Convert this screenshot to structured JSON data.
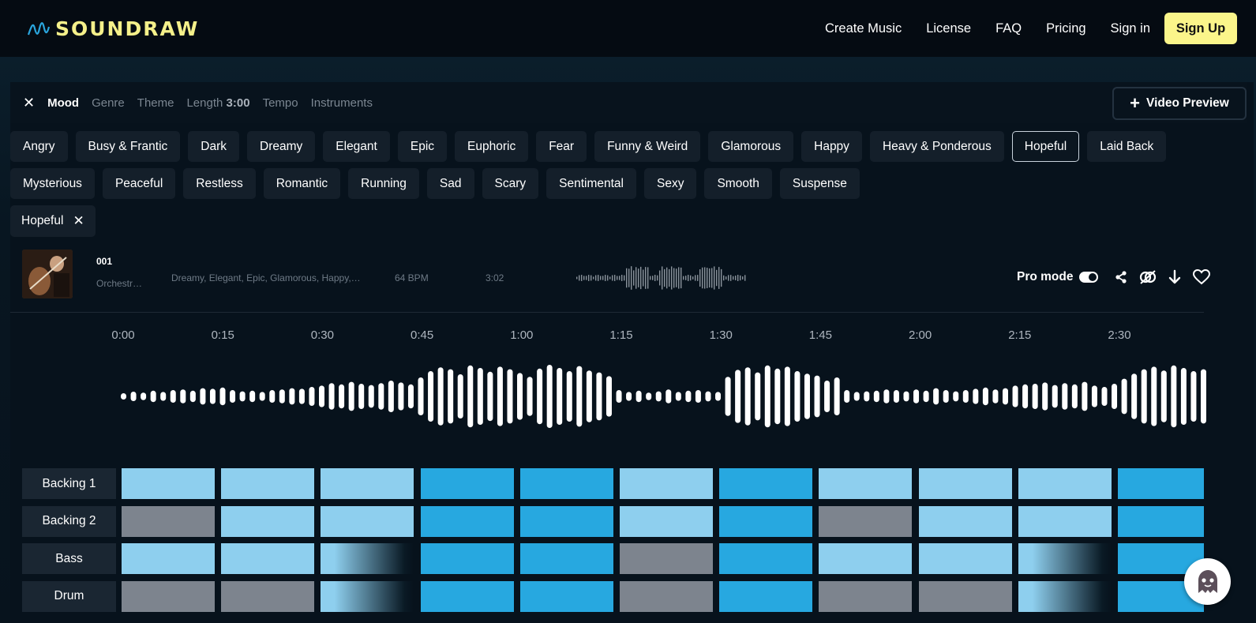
{
  "header": {
    "logo_text": "SOUNDRAW",
    "nav": [
      "Create Music",
      "License",
      "FAQ",
      "Pricing",
      "Sign in"
    ],
    "signup_label": "Sign Up"
  },
  "filters": {
    "tabs": [
      "Mood",
      "Genre",
      "Theme",
      "Tempo",
      "Instruments"
    ],
    "length_label": "Length",
    "length_value": "3:00",
    "video_preview_label": "Video Preview"
  },
  "moods": {
    "row1": [
      "Angry",
      "Busy & Frantic",
      "Dark",
      "Dreamy",
      "Elegant",
      "Epic",
      "Euphoric",
      "Fear",
      "Funny & Weird",
      "Glamorous",
      "Happy",
      "Heavy & Ponderous",
      "Hopeful",
      "Laid Back"
    ],
    "row2": [
      "Mysterious",
      "Peaceful",
      "Restless",
      "Romantic",
      "Running",
      "Sad",
      "Scary",
      "Sentimental",
      "Sexy",
      "Smooth",
      "Suspense"
    ],
    "selected": "Hopeful"
  },
  "selected_filter": {
    "label": "Hopeful"
  },
  "track": {
    "id": "001",
    "genre": "Orchestr…",
    "moods": "Dreamy, Elegant, Epic, Glamorous, Happy,…",
    "bpm": "64 BPM",
    "length": "3:02",
    "pro_mode_label": "Pro mode",
    "pro_mode_on": true
  },
  "timeline": [
    "0:00",
    "0:15",
    "0:30",
    "0:45",
    "1:00",
    "1:15",
    "1:30",
    "1:45",
    "2:00",
    "2:15",
    "2:30"
  ],
  "waveform_levels": [
    0.1,
    0.15,
    0.12,
    0.18,
    0.14,
    0.2,
    0.22,
    0.18,
    0.26,
    0.24,
    0.28,
    0.2,
    0.16,
    0.18,
    0.14,
    0.2,
    0.22,
    0.26,
    0.24,
    0.3,
    0.34,
    0.42,
    0.38,
    0.46,
    0.4,
    0.36,
    0.42,
    0.5,
    0.44,
    0.38,
    0.6,
    0.8,
    0.92,
    0.86,
    0.7,
    0.98,
    0.9,
    0.78,
    0.94,
    0.86,
    0.74,
    0.62,
    0.88,
    1.0,
    0.9,
    0.8,
    0.96,
    0.82,
    0.76,
    0.64,
    0.2,
    0.14,
    0.18,
    0.12,
    0.16,
    0.22,
    0.14,
    0.18,
    0.2,
    0.16,
    0.14,
    0.62,
    0.84,
    0.92,
    0.76,
    0.98,
    0.88,
    0.94,
    0.8,
    0.72,
    0.66,
    0.5,
    0.6,
    0.2,
    0.14,
    0.16,
    0.18,
    0.22,
    0.2,
    0.16,
    0.22,
    0.18,
    0.26,
    0.2,
    0.16,
    0.2,
    0.24,
    0.28,
    0.22,
    0.26,
    0.34,
    0.38,
    0.4,
    0.44,
    0.36,
    0.42,
    0.38,
    0.46,
    0.34,
    0.3,
    0.4,
    0.56,
    0.72,
    0.86,
    0.94,
    0.82,
    0.98,
    0.9,
    0.8,
    0.86
  ],
  "instruments": [
    {
      "label": "Backing 1",
      "cells": [
        "light",
        "light",
        "light",
        "bright",
        "bright",
        "light",
        "bright",
        "light",
        "light",
        "light",
        "bright"
      ]
    },
    {
      "label": "Backing 2",
      "cells": [
        "gray",
        "light",
        "light",
        "bright",
        "bright",
        "light",
        "bright",
        "gray",
        "light",
        "light",
        "bright"
      ]
    },
    {
      "label": "Bass",
      "cells": [
        "light",
        "light",
        "fade",
        "bright",
        "bright",
        "gray",
        "bright",
        "light",
        "light",
        "fade",
        "bright"
      ]
    },
    {
      "label": "Drum",
      "cells": [
        "gray",
        "gray",
        "fade",
        "bright",
        "bright",
        "gray",
        "bright",
        "gray",
        "gray",
        "fade",
        "bright"
      ]
    }
  ],
  "colors": {
    "accent": "#fbf58a",
    "cell_light": "#8ecfee",
    "cell_bright": "#27a8e0",
    "cell_gray": "#7d848e"
  }
}
